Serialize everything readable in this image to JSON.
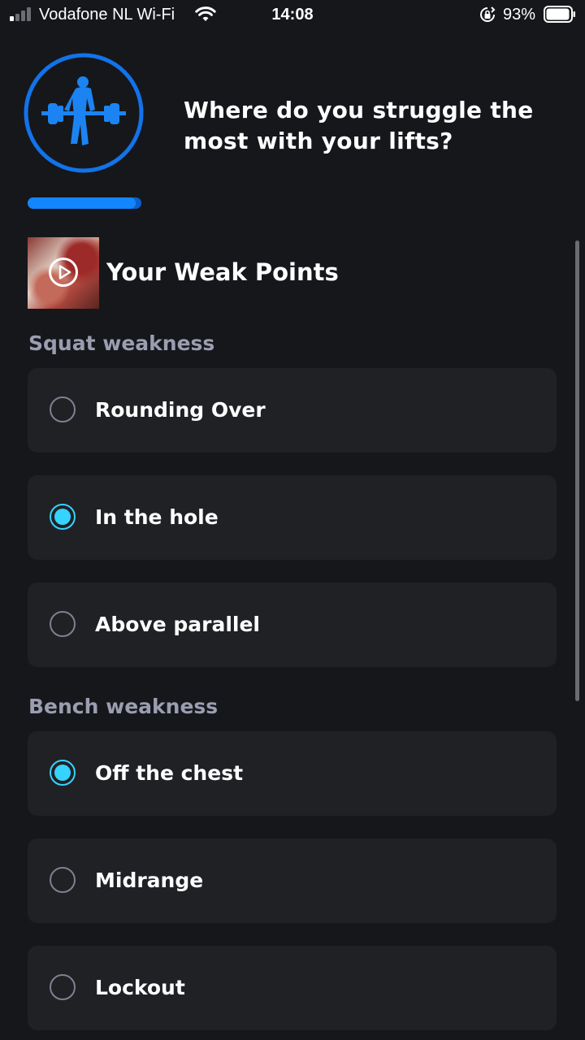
{
  "status_bar": {
    "carrier": "Vodafone NL Wi-Fi",
    "time": "14:08",
    "battery": "93%"
  },
  "header": {
    "question": "Where do you struggle the most with your lifts?",
    "progress": 0.95,
    "logo_icon": "powerlifter-deadlift-icon"
  },
  "section": {
    "title": "Your Weak Points",
    "thumb_icon": "play-icon"
  },
  "groups": [
    {
      "label": "Squat weakness",
      "options": [
        {
          "label": "Rounding Over",
          "selected": false
        },
        {
          "label": "In the hole",
          "selected": true
        },
        {
          "label": "Above parallel",
          "selected": false
        }
      ]
    },
    {
      "label": "Bench weakness",
      "options": [
        {
          "label": "Off the chest",
          "selected": true
        },
        {
          "label": "Midrange",
          "selected": false
        },
        {
          "label": "Lockout",
          "selected": false
        }
      ]
    }
  ],
  "colors": {
    "accent": "#1385ff",
    "radio_selected": "#35d3ff",
    "background": "#16171b",
    "card": "#202125"
  }
}
